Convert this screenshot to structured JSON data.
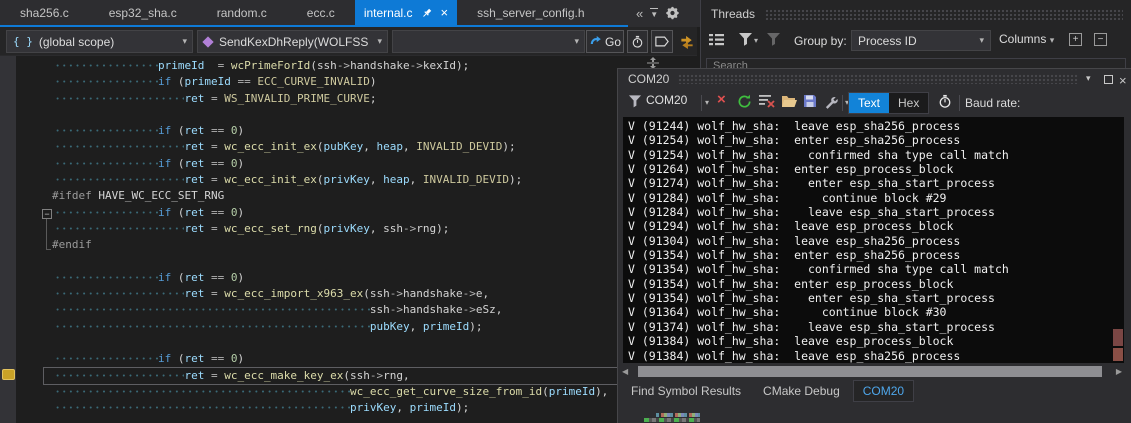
{
  "icons": {
    "overflow_chevrons": "«",
    "tab_list_arrow": "▼",
    "combo_arrow": "▾",
    "close_glyph": "×",
    "minus_glyph": "−",
    "plus_glyph": "+",
    "braces_glyph": "{ }",
    "left_arrow_glyph": "◀",
    "right_arrow_glyph": "▶"
  },
  "tab_bar": {
    "tabs": [
      {
        "label": "sha256.c",
        "active": false
      },
      {
        "label": "esp32_sha.c",
        "active": false
      },
      {
        "label": "random.c",
        "active": false
      },
      {
        "label": "ecc.c",
        "active": false
      },
      {
        "label": "internal.c",
        "active": true
      },
      {
        "label": "ssh_server_config.h",
        "active": false
      }
    ]
  },
  "navbar": {
    "scope_label": "(global scope)",
    "member_label": "SendKexDhReply(WOLFSSH",
    "go_label": "Go"
  },
  "threads_panel": {
    "title": "Threads",
    "group_by_label": "Group by:",
    "group_by_value": "Process ID",
    "columns_label": "Columns",
    "search_placeholder": "Search"
  },
  "editor": {
    "current_line_index": 19,
    "collapse_line_index": 9,
    "bookmark_line_index": 19,
    "lines": [
      {
        "ind": 16,
        "seg": [
          [
            "v",
            "primeId"
          ],
          [
            "p",
            "  "
          ],
          [
            "o",
            "="
          ],
          [
            "p",
            " "
          ],
          [
            "f",
            "wcPrimeForId"
          ],
          [
            "p",
            "("
          ],
          [
            "p",
            "ssh"
          ],
          [
            "o",
            "->"
          ],
          [
            "p",
            "handshake"
          ],
          [
            "o",
            "->"
          ],
          [
            "p",
            "kexId"
          ],
          [
            "p",
            ");"
          ]
        ]
      },
      {
        "ind": 16,
        "seg": [
          [
            "k",
            "if"
          ],
          [
            "p",
            " ("
          ],
          [
            "v",
            "primeId"
          ],
          [
            "p",
            " "
          ],
          [
            "o",
            "=="
          ],
          [
            "p",
            " "
          ],
          [
            "m",
            "ECC_CURVE_INVALID"
          ],
          [
            "p",
            ")"
          ]
        ]
      },
      {
        "ind": 20,
        "seg": [
          [
            "v",
            "ret"
          ],
          [
            "p",
            " "
          ],
          [
            "o",
            "="
          ],
          [
            "p",
            " "
          ],
          [
            "m",
            "WS_INVALID_PRIME_CURVE"
          ],
          [
            "p",
            ";"
          ]
        ]
      },
      {
        "ind": 0,
        "seg": []
      },
      {
        "ind": 16,
        "seg": [
          [
            "k",
            "if"
          ],
          [
            "p",
            " ("
          ],
          [
            "v",
            "ret"
          ],
          [
            "p",
            " "
          ],
          [
            "o",
            "=="
          ],
          [
            "p",
            " "
          ],
          [
            "n",
            "0"
          ],
          [
            "p",
            ")"
          ]
        ]
      },
      {
        "ind": 20,
        "seg": [
          [
            "v",
            "ret"
          ],
          [
            "p",
            " "
          ],
          [
            "o",
            "="
          ],
          [
            "p",
            " "
          ],
          [
            "f",
            "wc_ecc_init_ex"
          ],
          [
            "p",
            "("
          ],
          [
            "v",
            "pubKey"
          ],
          [
            "p",
            ", "
          ],
          [
            "v",
            "heap"
          ],
          [
            "p",
            ", "
          ],
          [
            "m",
            "INVALID_DEVID"
          ],
          [
            "p",
            ");"
          ]
        ]
      },
      {
        "ind": 16,
        "seg": [
          [
            "k",
            "if"
          ],
          [
            "p",
            " ("
          ],
          [
            "v",
            "ret"
          ],
          [
            "p",
            " "
          ],
          [
            "o",
            "=="
          ],
          [
            "p",
            " "
          ],
          [
            "n",
            "0"
          ],
          [
            "p",
            ")"
          ]
        ]
      },
      {
        "ind": 20,
        "seg": [
          [
            "v",
            "ret"
          ],
          [
            "p",
            " "
          ],
          [
            "o",
            "="
          ],
          [
            "p",
            " "
          ],
          [
            "f",
            "wc_ecc_init_ex"
          ],
          [
            "p",
            "("
          ],
          [
            "v",
            "privKey"
          ],
          [
            "p",
            ", "
          ],
          [
            "v",
            "heap"
          ],
          [
            "p",
            ", "
          ],
          [
            "m",
            "INVALID_DEVID"
          ],
          [
            "p",
            ");"
          ]
        ]
      },
      {
        "ind": 0,
        "seg": [
          [
            "d",
            "#ifdef"
          ],
          [
            "p",
            " "
          ],
          [
            "p",
            "HAVE_WC_ECC_SET_RNG"
          ]
        ]
      },
      {
        "ind": 16,
        "seg": [
          [
            "k",
            "if"
          ],
          [
            "p",
            " ("
          ],
          [
            "v",
            "ret"
          ],
          [
            "p",
            " "
          ],
          [
            "o",
            "=="
          ],
          [
            "p",
            " "
          ],
          [
            "n",
            "0"
          ],
          [
            "p",
            ")"
          ]
        ]
      },
      {
        "ind": 20,
        "seg": [
          [
            "v",
            "ret"
          ],
          [
            "p",
            " "
          ],
          [
            "o",
            "="
          ],
          [
            "p",
            " "
          ],
          [
            "f",
            "wc_ecc_set_rng"
          ],
          [
            "p",
            "("
          ],
          [
            "v",
            "privKey"
          ],
          [
            "p",
            ", "
          ],
          [
            "p",
            "ssh"
          ],
          [
            "o",
            "->"
          ],
          [
            "p",
            "rng"
          ],
          [
            "p",
            ");"
          ]
        ]
      },
      {
        "ind": 0,
        "seg": [
          [
            "d",
            "#endif"
          ]
        ]
      },
      {
        "ind": 0,
        "seg": []
      },
      {
        "ind": 16,
        "seg": [
          [
            "k",
            "if"
          ],
          [
            "p",
            " ("
          ],
          [
            "v",
            "ret"
          ],
          [
            "p",
            " "
          ],
          [
            "o",
            "=="
          ],
          [
            "p",
            " "
          ],
          [
            "n",
            "0"
          ],
          [
            "p",
            ")"
          ]
        ]
      },
      {
        "ind": 20,
        "seg": [
          [
            "v",
            "ret"
          ],
          [
            "p",
            " "
          ],
          [
            "o",
            "="
          ],
          [
            "p",
            " "
          ],
          [
            "f",
            "wc_ecc_import_x963_ex"
          ],
          [
            "p",
            "("
          ],
          [
            "p",
            "ssh"
          ],
          [
            "o",
            "->"
          ],
          [
            "p",
            "handshake"
          ],
          [
            "o",
            "->"
          ],
          [
            "p",
            "e"
          ],
          [
            "p",
            ","
          ]
        ]
      },
      {
        "ind": 48,
        "seg": [
          [
            "p",
            "ssh"
          ],
          [
            "o",
            "->"
          ],
          [
            "p",
            "handshake"
          ],
          [
            "o",
            "->"
          ],
          [
            "p",
            "eSz"
          ],
          [
            "p",
            ","
          ]
        ]
      },
      {
        "ind": 48,
        "seg": [
          [
            "v",
            "pubKey"
          ],
          [
            "p",
            ", "
          ],
          [
            "v",
            "primeId"
          ],
          [
            "p",
            ");"
          ]
        ]
      },
      {
        "ind": 0,
        "seg": []
      },
      {
        "ind": 16,
        "seg": [
          [
            "k",
            "if"
          ],
          [
            "p",
            " ("
          ],
          [
            "v",
            "ret"
          ],
          [
            "p",
            " "
          ],
          [
            "o",
            "=="
          ],
          [
            "p",
            " "
          ],
          [
            "n",
            "0"
          ],
          [
            "p",
            ")"
          ]
        ]
      },
      {
        "ind": 20,
        "seg": [
          [
            "v",
            "ret"
          ],
          [
            "p",
            " "
          ],
          [
            "o",
            "="
          ],
          [
            "p",
            " "
          ],
          [
            "f",
            "wc_ecc_make_key_ex"
          ],
          [
            "p",
            "("
          ],
          [
            "p",
            "ssh"
          ],
          [
            "o",
            "->"
          ],
          [
            "p",
            "rng"
          ],
          [
            "p",
            ","
          ]
        ]
      },
      {
        "ind": 45,
        "seg": [
          [
            "f",
            "wc_ecc_get_curve_size_from_id"
          ],
          [
            "p",
            "("
          ],
          [
            "v",
            "primeId"
          ],
          [
            "p",
            "),"
          ]
        ]
      },
      {
        "ind": 45,
        "seg": [
          [
            "v",
            "privKey"
          ],
          [
            "p",
            ", "
          ],
          [
            "v",
            "primeId"
          ],
          [
            "p",
            ");"
          ]
        ]
      }
    ]
  },
  "com_panel": {
    "title": "COM20",
    "port_selector": "COM20",
    "text_button": "Text",
    "hex_button": "Hex",
    "baud_label": "Baud rate:",
    "log_lines": [
      "V (91244) wolf_hw_sha:  leave esp_sha256_process",
      "V (91254) wolf_hw_sha:  enter esp_sha256_process",
      "V (91254) wolf_hw_sha:    confirmed sha type call match",
      "V (91264) wolf_hw_sha:  enter esp_process_block",
      "V (91274) wolf_hw_sha:    enter esp_sha_start_process",
      "V (91284) wolf_hw_sha:      continue block #29",
      "V (91284) wolf_hw_sha:    leave esp_sha_start_process",
      "V (91294) wolf_hw_sha:  leave esp_process_block",
      "V (91304) wolf_hw_sha:  leave esp_sha256_process",
      "V (91354) wolf_hw_sha:  enter esp_sha256_process",
      "V (91354) wolf_hw_sha:    confirmed sha type call match",
      "V (91354) wolf_hw_sha:  enter esp_process_block",
      "V (91354) wolf_hw_sha:    enter esp_sha_start_process",
      "V (91364) wolf_hw_sha:      continue block #30",
      "V (91374) wolf_hw_sha:    leave esp_sha_start_process",
      "V (91384) wolf_hw_sha:  leave esp_process_block",
      "V (91384) wolf_hw_sha:  leave esp_sha256_process"
    ],
    "bottom_tabs": [
      "Find Symbol Results",
      "CMake Debug",
      "COM20"
    ],
    "active_bottom_tab": "COM20"
  },
  "colors": {
    "accent_blue": "#0E7AD6",
    "text_button_blue": "#1283D8",
    "console_bg": "#0C0C0C",
    "console_fg": "#F0F0F0",
    "bookmark_gold": "#C9A227",
    "refresh_green": "#3FBF3F",
    "error_red": "#E05050"
  }
}
